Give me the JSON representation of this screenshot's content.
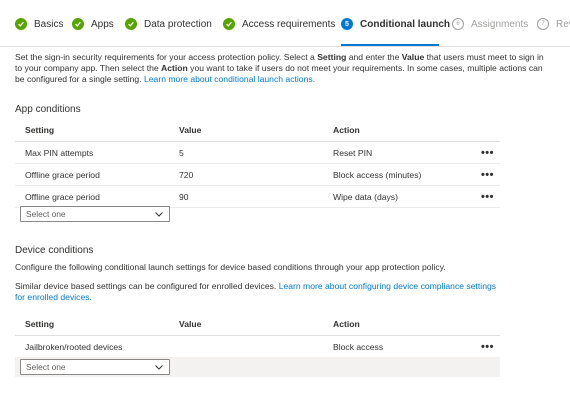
{
  "steps": [
    {
      "label": "Basics",
      "state": "done"
    },
    {
      "label": "Apps",
      "state": "done"
    },
    {
      "label": "Data protection",
      "state": "done"
    },
    {
      "label": "Access requirements",
      "state": "done"
    },
    {
      "label": "Conditional launch",
      "state": "current",
      "number": "5"
    },
    {
      "label": "Assignments",
      "state": "future",
      "number": "6"
    },
    {
      "label": "Rev",
      "state": "future",
      "number": "7"
    }
  ],
  "intro": {
    "text_1": "Set the sign-in security requirements for your access protection policy. Select a ",
    "bold_1": "Setting",
    "text_2": " and enter the ",
    "bold_2": "Value",
    "text_3": " that users must meet to sign in to your company app. Then select the ",
    "bold_3": "Action",
    "text_4": " you want to take if users do not meet your requirements. In some cases, multiple actions can be configured for a single setting. ",
    "link": "Learn more about conditional launch actions."
  },
  "app_conditions": {
    "title": "App conditions",
    "columns": [
      "Setting",
      "Value",
      "Action"
    ],
    "rows": [
      {
        "setting": "Max PIN attempts",
        "value": "5",
        "action": "Reset PIN"
      },
      {
        "setting": "Offline grace period",
        "value": "720",
        "action": "Block access (minutes)"
      },
      {
        "setting": "Offline grace period",
        "value": "90",
        "action": "Wipe data (days)"
      }
    ],
    "select_placeholder": "Select one"
  },
  "device_conditions": {
    "title": "Device conditions",
    "description": "Configure the following conditional launch settings for device based conditions through your app protection policy.",
    "similar_text": "Similar device based settings can be configured for enrolled devices. ",
    "similar_link": "Learn more about configuring device compliance settings for enrolled devices.",
    "columns": [
      "Setting",
      "Value",
      "Action"
    ],
    "rows": [
      {
        "setting": "Jailbroken/rooted devices",
        "value": "",
        "action": "Block access"
      }
    ],
    "select_placeholder": "Select one"
  },
  "more_label": "•••",
  "colors": {
    "accent": "#0078d4",
    "done": "#57a300",
    "link": "#0078d4",
    "shaded_row": "#f3f2f1"
  },
  "icons": {
    "done": "checkmark-icon",
    "more": "more-options-icon",
    "select": "chevron-down-icon"
  }
}
